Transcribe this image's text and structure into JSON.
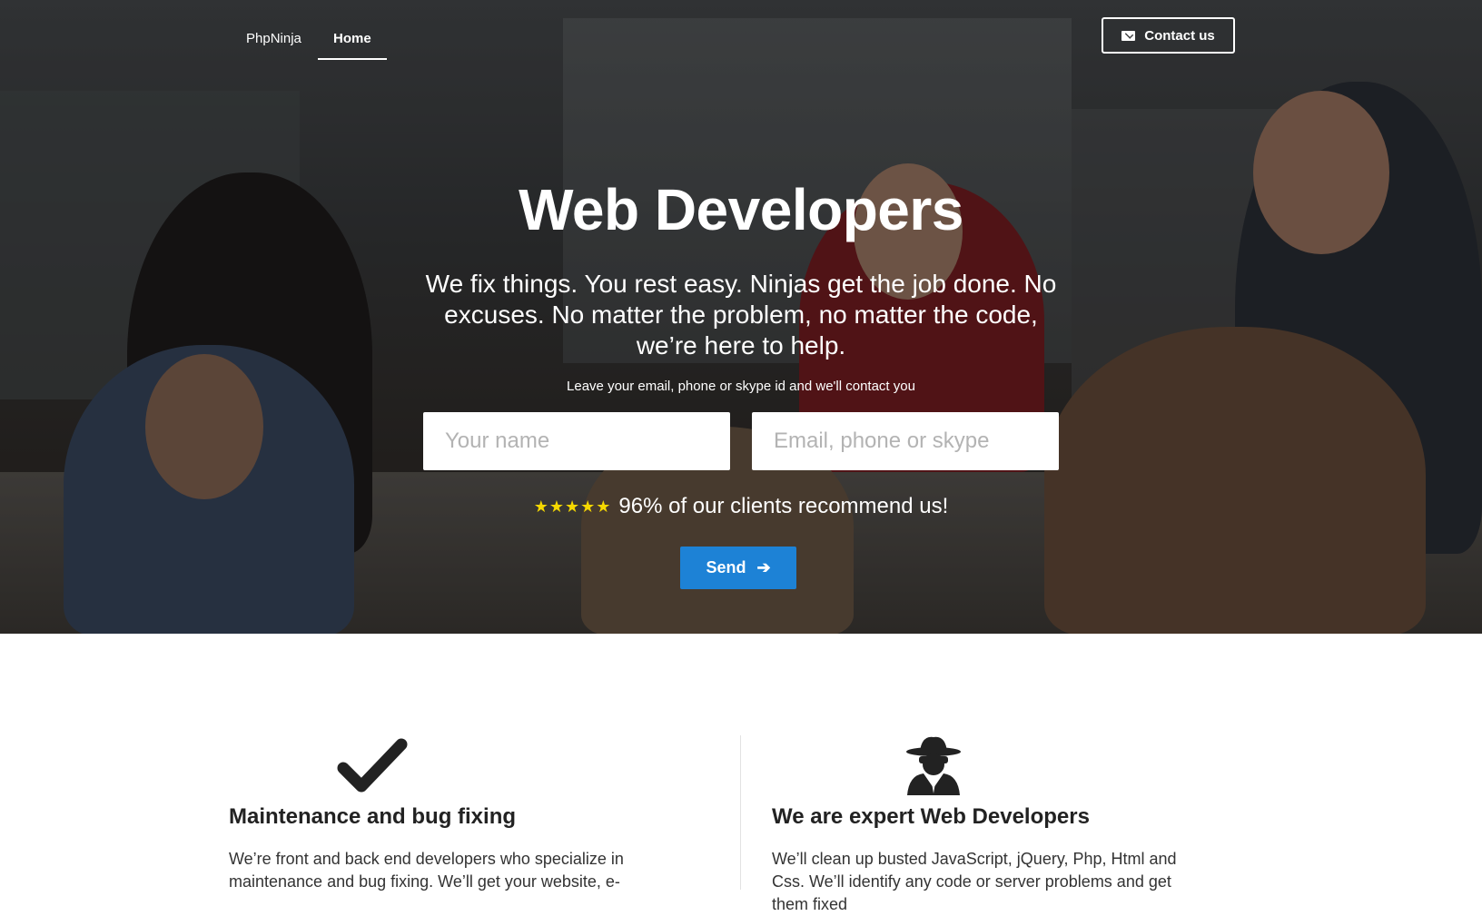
{
  "nav": {
    "brand": "PhpNinja",
    "home": "Home",
    "contact_label": "Contact us",
    "contact_icon": "envelope-icon"
  },
  "hero": {
    "title": "Web Developers",
    "subtitle": "We fix things. You rest easy. Ninjas get the job done. No excuses. No matter the problem, no matter the code, we’re here to help.",
    "hint": "Leave your email, phone or skype id and we'll contact you",
    "name_placeholder": "Your name",
    "contact_placeholder": "Email, phone or skype",
    "stars": "★★★★★",
    "rating_text": "96% of our clients recommend us!",
    "rating_stars": 5,
    "send_label": "Send",
    "send_icon": "arrow-right-icon"
  },
  "features": [
    {
      "icon": "checkmark-icon",
      "title": "Maintenance and bug fixing",
      "text": "We’re front and back end developers who specialize in maintenance and bug fixing. We’ll get your website, e-"
    },
    {
      "icon": "spy-icon",
      "title": "We are expert Web Developers",
      "text": "We’ll clean up busted JavaScript, jQuery, Php, Html and Css. We’ll identify any code or server problems and get them fixed"
    }
  ],
  "colors": {
    "accent": "#1d82d6",
    "star": "#f5d800",
    "text_dark": "#222222"
  }
}
